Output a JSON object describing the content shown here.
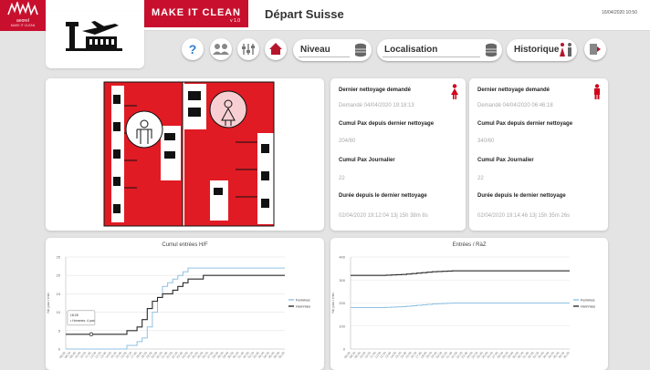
{
  "brand": {
    "name": "aeorel",
    "tagline": "MAKE IT CLEAN"
  },
  "app": {
    "title": "MAKE IT CLEAN",
    "version": "v 1.0"
  },
  "page": {
    "title": "Départ Suisse",
    "datetime": "16/04/2020 10:50"
  },
  "toolbar": {
    "help_label": "?",
    "niveau_label": "Niveau",
    "localisation_label": "Localisation",
    "historique_label": "Historique"
  },
  "colors": {
    "brand_red": "#c8102e",
    "femmes": "#8fc1e3",
    "hommes": "#2a2a2a"
  },
  "cards": [
    {
      "gender": "femmes",
      "last_cleaning_label": "Dernier nettoyage demandé",
      "last_cleaning_value": "Demandé 04/04/2020 19:18:13",
      "cumul_label": "Cumul Pax depuis dernier nettoyage",
      "cumul_value": "204/60",
      "daily_label": "Cumul Pax Journalier",
      "daily_value": "22",
      "duration_label": "Durée depuis le dernier nettoyage",
      "duration_value": "02/04/2020 19:12:04 13j 15h 38m 8s"
    },
    {
      "gender": "hommes",
      "last_cleaning_label": "Dernier nettoyage demandé",
      "last_cleaning_value": "Demandé 04/04/2020 06:46:18",
      "cumul_label": "Cumul Pax depuis dernier nettoyage",
      "cumul_value": "340/60",
      "daily_label": "Cumul Pax Journalier",
      "daily_value": "22",
      "duration_label": "Durée depuis le dernier nettoyage",
      "duration_value": "02/04/2020 19:14:46 13j 15h 35m 26s"
    }
  ],
  "chart_data": [
    {
      "type": "line",
      "title": "Cumul entrées H/F",
      "ylabel": "Nb pax / min",
      "ylim": [
        0,
        25
      ],
      "yticks": [
        0,
        5,
        10,
        15,
        20,
        25
      ],
      "steps": 44,
      "series": [
        {
          "name": "Femmes",
          "color": "#8fc1e3",
          "values": [
            0,
            0,
            0,
            0,
            0,
            0,
            0,
            0,
            0,
            0,
            0,
            0,
            1,
            1,
            2,
            3,
            6,
            10,
            14,
            17,
            18,
            19,
            20,
            21,
            22,
            22,
            22,
            22,
            22,
            22,
            22,
            22,
            22,
            22,
            22,
            22,
            22,
            22,
            22,
            22,
            22,
            22,
            22,
            22
          ]
        },
        {
          "name": "Hommes",
          "color": "#2a2a2a",
          "values": [
            4,
            4,
            4,
            4,
            4,
            4,
            4,
            4,
            4,
            4,
            4,
            4,
            5,
            5,
            6,
            8,
            11,
            13,
            14,
            15,
            15,
            16,
            17,
            18,
            19,
            19,
            19,
            20,
            20,
            20,
            20,
            20,
            20,
            20,
            20,
            20,
            20,
            20,
            20,
            20,
            20,
            20,
            20,
            20
          ]
        }
      ],
      "tooltip": {
        "time": "18:28",
        "series": "Hommes",
        "value": "4 pax"
      }
    },
    {
      "type": "line",
      "title": "Entrées / RàZ",
      "ylabel": "Nb pax / min",
      "ylim": [
        0,
        400
      ],
      "yticks": [
        0,
        100,
        200,
        300,
        400
      ],
      "steps": 44,
      "series": [
        {
          "name": "Femmes",
          "color": "#8fc1e3",
          "values": [
            180,
            180,
            180,
            180,
            180,
            180,
            180,
            181,
            182,
            183,
            184,
            186,
            188,
            190,
            192,
            194,
            196,
            197,
            198,
            199,
            200,
            200,
            200,
            200,
            200,
            200,
            200,
            200,
            200,
            200,
            200,
            200,
            200,
            200,
            200,
            200,
            200,
            200,
            200,
            200,
            200,
            200,
            200,
            200
          ]
        },
        {
          "name": "Hommes",
          "color": "#2a2a2a",
          "values": [
            320,
            320,
            320,
            320,
            320,
            320,
            320,
            321,
            322,
            323,
            324,
            326,
            328,
            330,
            332,
            334,
            336,
            337,
            338,
            339,
            340,
            340,
            340,
            340,
            340,
            340,
            340,
            340,
            340,
            340,
            340,
            340,
            340,
            340,
            340,
            340,
            340,
            340,
            340,
            340,
            340,
            340,
            340,
            340
          ]
        }
      ]
    }
  ]
}
